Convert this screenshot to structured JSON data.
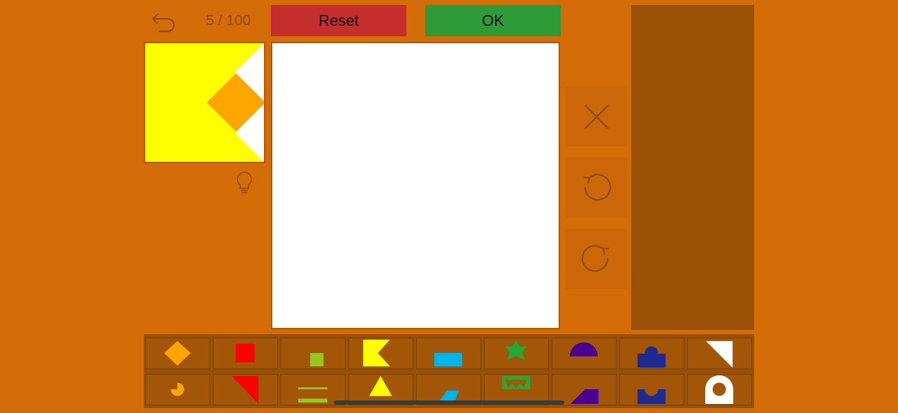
{
  "level": {
    "progress": "5 / 100"
  },
  "buttons": {
    "reset_label": "Reset",
    "ok_label": "OK"
  },
  "icons": {
    "back": "undo-arrow-icon",
    "hint": "lightbulb-icon",
    "delete": "close-icon",
    "rotate_ccw": "rotate-counterclockwise-icon",
    "rotate_cw": "rotate-clockwise-icon"
  },
  "colors": {
    "background": "#D46D08",
    "reset": "#C62D2D",
    "ok": "#2F9A38",
    "panel": "#9A5005",
    "board": "#FFFFFF"
  },
  "target_pieces": [
    {
      "shape": "chevron-notch",
      "color": "#FFFF00"
    },
    {
      "shape": "diamond",
      "color": "#FFA500"
    }
  ],
  "palette": [
    [
      {
        "shape": "diamond",
        "color": "#FFA500"
      },
      {
        "shape": "square",
        "color": "#FF0000"
      },
      {
        "shape": "small-square",
        "color": "#9AC520"
      },
      {
        "shape": "chevron-notch",
        "color": "#FFFF00"
      },
      {
        "shape": "rectangle",
        "color": "#00B4E8"
      },
      {
        "shape": "star",
        "color": "#22AA33"
      },
      {
        "shape": "semicircle",
        "color": "#4B0090"
      },
      {
        "shape": "keyhole-block",
        "color": "#1E2A90"
      },
      {
        "shape": "right-triangle",
        "color": "#FFFFFF"
      }
    ],
    [
      {
        "shape": "pacman",
        "color": "#FFA500"
      },
      {
        "shape": "long-triangle",
        "color": "#FF0000"
      },
      {
        "shape": "lines",
        "color": "#9AC520"
      },
      {
        "shape": "triangle",
        "color": "#FFFF00"
      },
      {
        "shape": "parallelogram",
        "color": "#00B4E8"
      },
      {
        "shape": "crown",
        "color": "#22AA33"
      },
      {
        "shape": "wedge",
        "color": "#4B0090"
      },
      {
        "shape": "cup-block",
        "color": "#1E2A90"
      },
      {
        "shape": "ring",
        "color": "#FFFFFF"
      }
    ]
  ]
}
